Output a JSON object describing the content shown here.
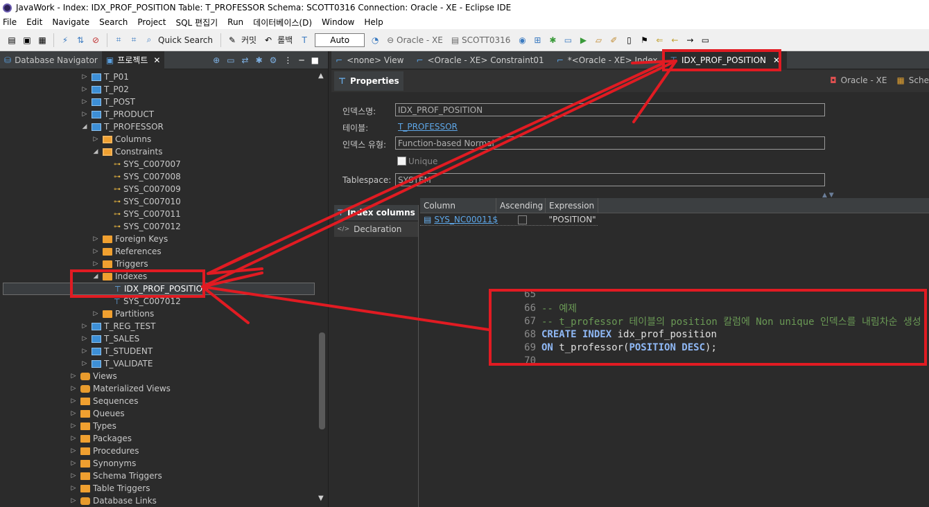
{
  "window": {
    "title": "JavaWork - Index: IDX_PROF_POSITION Table: T_PROFESSOR Schema: SCOTT0316 Connection: Oracle - XE - Eclipse IDE"
  },
  "menu": [
    "File",
    "Edit",
    "Navigate",
    "Search",
    "Project",
    "SQL 편집기",
    "Run",
    "데이터베이스(D)",
    "Window",
    "Help"
  ],
  "toolbar": {
    "quick_search": "Quick Search",
    "commit": "커밋",
    "rollback": "롤백",
    "mode": "Auto",
    "connection": "Oracle - XE",
    "schema": "SCOTT0316"
  },
  "left_tabs": {
    "navigator": "Database Navigator",
    "project": "프로젝트"
  },
  "tree": [
    {
      "label": "T_P01",
      "type": "table",
      "depth": 1,
      "expanded": false
    },
    {
      "label": "T_P02",
      "type": "table",
      "depth": 1,
      "expanded": false
    },
    {
      "label": "T_POST",
      "type": "table",
      "depth": 1,
      "expanded": false
    },
    {
      "label": "T_PRODUCT",
      "type": "table",
      "depth": 1,
      "expanded": false
    },
    {
      "label": "T_PROFESSOR",
      "type": "table",
      "depth": 1,
      "expanded": true
    },
    {
      "label": "Columns",
      "type": "columns",
      "depth": 2,
      "expanded": false
    },
    {
      "label": "Constraints",
      "type": "columns",
      "depth": 2,
      "expanded": true
    },
    {
      "label": "SYS_C007007",
      "type": "key",
      "depth": 3
    },
    {
      "label": "SYS_C007008",
      "type": "key",
      "depth": 3
    },
    {
      "label": "SYS_C007009",
      "type": "key",
      "depth": 3
    },
    {
      "label": "SYS_C007010",
      "type": "key",
      "depth": 3
    },
    {
      "label": "SYS_C007011",
      "type": "key",
      "depth": 3
    },
    {
      "label": "SYS_C007012",
      "type": "key",
      "depth": 3
    },
    {
      "label": "Foreign Keys",
      "type": "folder",
      "depth": 2,
      "expanded": false
    },
    {
      "label": "References",
      "type": "folder",
      "depth": 2,
      "expanded": false
    },
    {
      "label": "Triggers",
      "type": "folder",
      "depth": 2,
      "expanded": false
    },
    {
      "label": "Indexes",
      "type": "folder",
      "depth": 2,
      "expanded": true
    },
    {
      "label": "IDX_PROF_POSITION",
      "type": "index",
      "depth": 3,
      "selected": true
    },
    {
      "label": "SYS_C007012",
      "type": "index",
      "depth": 3
    },
    {
      "label": "Partitions",
      "type": "folder",
      "depth": 2,
      "expanded": false
    },
    {
      "label": "T_REG_TEST",
      "type": "table",
      "depth": 1,
      "expanded": false
    },
    {
      "label": "T_SALES",
      "type": "table",
      "depth": 1,
      "expanded": false
    },
    {
      "label": "T_STUDENT",
      "type": "table",
      "depth": 1,
      "expanded": false
    },
    {
      "label": "T_VALIDATE",
      "type": "table",
      "depth": 1,
      "expanded": false
    },
    {
      "label": "Views",
      "type": "view",
      "depth": 0,
      "expanded": false
    },
    {
      "label": "Materialized Views",
      "type": "view",
      "depth": 0,
      "expanded": false
    },
    {
      "label": "Sequences",
      "type": "folder",
      "depth": 0,
      "expanded": false
    },
    {
      "label": "Queues",
      "type": "folder",
      "depth": 0,
      "expanded": false
    },
    {
      "label": "Types",
      "type": "folder",
      "depth": 0,
      "expanded": false
    },
    {
      "label": "Packages",
      "type": "folder",
      "depth": 0,
      "expanded": false
    },
    {
      "label": "Procedures",
      "type": "folder",
      "depth": 0,
      "expanded": false
    },
    {
      "label": "Synonyms",
      "type": "folder",
      "depth": 0,
      "expanded": false
    },
    {
      "label": "Schema Triggers",
      "type": "folder",
      "depth": 0,
      "expanded": false
    },
    {
      "label": "Table Triggers",
      "type": "folder",
      "depth": 0,
      "expanded": false
    },
    {
      "label": "Database Links",
      "type": "view",
      "depth": 0,
      "expanded": false
    }
  ],
  "editor_tabs": [
    {
      "label": "<none> View",
      "active": false
    },
    {
      "label": "<Oracle - XE> Constraint01",
      "active": false
    },
    {
      "label": "*<Oracle - XE> Index",
      "active": false
    },
    {
      "label": "IDX_PROF_POSITION",
      "active": true
    }
  ],
  "properties": {
    "tab": "Properties",
    "connection": "Oracle - XE",
    "schema_short": "Sche",
    "index_name_label": "인덱스명:",
    "index_name": "IDX_PROF_POSITION",
    "table_label": "테이블:",
    "table": "T_PROFESSOR",
    "index_type_label": "인덱스 유형:",
    "index_type": "Function-based Normal",
    "unique_label": "Unique",
    "tablespace_label": "Tablespace:",
    "tablespace": "SYSTEM"
  },
  "index_panel": {
    "columns_tab": "Index columns",
    "declaration_tab": "Declaration",
    "headers": [
      "Column",
      "Ascending",
      "Expression"
    ],
    "rows": [
      {
        "column": "SYS_NC00011$",
        "ascending": false,
        "expression": "\"POSITION\""
      }
    ]
  },
  "code": [
    {
      "n": "65",
      "text": ""
    },
    {
      "n": "66",
      "text": "-- 예제"
    },
    {
      "n": "67",
      "text": "-- t_professor 테이블의 position 칼럼에 Non unique 인덱스를 내림차순 생성"
    },
    {
      "n": "68",
      "kw1": "CREATE INDEX",
      "rest": " idx_prof_position"
    },
    {
      "n": "69",
      "kw1": "ON",
      "mid": " t_professor(",
      "kw2": "POSITION DESC",
      "end": ");"
    },
    {
      "n": "70",
      "text": ""
    }
  ],
  "colors": {
    "annotation": "#e11b22",
    "link": "#5ea8ea",
    "comment": "#6a9955"
  }
}
